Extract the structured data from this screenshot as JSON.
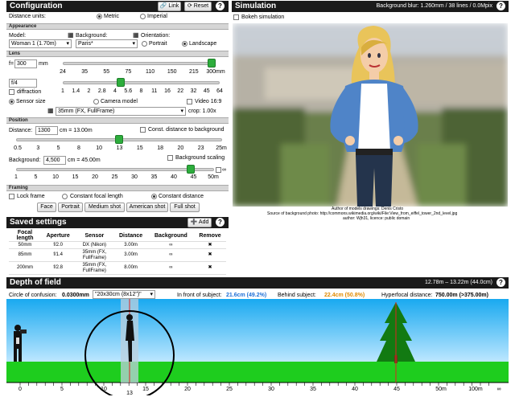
{
  "config": {
    "title": "Configuration",
    "link_label": "Link",
    "reset_label": "Reset",
    "help": "?",
    "distance_units_label": "Distance units:",
    "units": [
      "Metric",
      "Imperial"
    ],
    "appearance_label": "Appearance",
    "model_label": "Model:",
    "model_value": "Woman 1 (1.70m)",
    "background_label": "Background:",
    "background_value": "Paris*",
    "orientation_label": "Orientation:",
    "orientation_options": [
      "Portrait",
      "Landscape"
    ],
    "lens_label": "Lens",
    "focal_prefix": "f=",
    "focal_value": "300",
    "focal_unit": "mm",
    "focal_ticks": [
      "24",
      "35",
      "55",
      "75",
      "110",
      "150",
      "215",
      "300mm"
    ],
    "focal_level": 1.0,
    "aperture_value": "f/4",
    "aperture_ticks": [
      "1",
      "1.4",
      "2",
      "2.8",
      "4",
      "5.6",
      "8",
      "11",
      "16",
      "22",
      "32",
      "45",
      "64"
    ],
    "aperture_level": 0.36,
    "diffraction_label": "diffraction",
    "sensor_size_label": "Sensor size",
    "camera_model_label": "Camera model",
    "video_label": "Video 16:9",
    "sensor_value": "35mm (FX, FullFrame)",
    "crop_label": "crop: 1.00x",
    "position_label": "Position",
    "distance_label": "Distance:",
    "distance_value": "1300",
    "distance_equals": "cm = 13.00m",
    "const_distance_label": "Const. distance to background",
    "distance_ticks": [
      "0.5",
      "3",
      "5",
      "8",
      "10",
      "13",
      "15",
      "18",
      "20",
      "23",
      "25m"
    ],
    "distance_level": 0.5,
    "background_dist_label": "Background:",
    "background_dist_value": "4,500",
    "background_dist_equals": "cm = 45.00m",
    "background_scaling_label": "Background scaling",
    "background_ticks": [
      "1",
      "5",
      "10",
      "15",
      "20",
      "25",
      "30",
      "35",
      "40",
      "45",
      "50m"
    ],
    "background_level": 0.9,
    "infinity": "∞",
    "framing_label": "Framing",
    "lock_frame_label": "Lock frame",
    "constant_focal_label": "Constant focal length",
    "constant_distance_label": "Constant distance",
    "framing_buttons": [
      "Face",
      "Portrait",
      "Medium shot",
      "American shot",
      "Full shot"
    ]
  },
  "saved": {
    "title": "Saved settings",
    "add_label": "Add",
    "columns": [
      "Focal length",
      "Aperture",
      "Sensor",
      "Distance",
      "Background",
      "Remove"
    ],
    "rows": [
      {
        "focal": "50mm",
        "aperture": "f/2.0",
        "sensor": "DX (Nikon)",
        "distance": "3.00m",
        "background": "∞",
        "remove": "✖"
      },
      {
        "focal": "85mm",
        "aperture": "f/1.4",
        "sensor": "35mm (FX, FullFrame)",
        "distance": "3.00m",
        "background": "∞",
        "remove": "✖"
      },
      {
        "focal": "200mm",
        "aperture": "f/2.8",
        "sensor": "35mm (FX, FullFrame)",
        "distance": "8.00m",
        "background": "∞",
        "remove": "✖"
      }
    ]
  },
  "simulation": {
    "title": "Simulation",
    "blur_info": "Background blur: 1.260mm / 38 lines / 0.0Mpix",
    "help": "?",
    "bokeh_label": "Bokeh simulation",
    "credit_1": "Author of models drawings: Denis Cristo",
    "credit_2": "Source of background photo: http://commons.wikimedia.org/wiki/File:View_from_eiffel_tower_2nd_level.jpg",
    "credit_3": "author: Wjh31, licence: public domain"
  },
  "dof": {
    "title": "Depth of field",
    "range": "12.78m – 13.22m (44.0cm)",
    "help": "?",
    "coc_label": "Circle of confusion:",
    "coc_value": "0.0300mm",
    "print_value": "\"20x30cm (8x12\")\"",
    "front_label": "In front of subject:",
    "front_value": "21.6cm (49.2%)",
    "behind_label": "Behind subject:",
    "behind_value": "22.4cm (50.8%)",
    "hyper_label": "Hyperfocal distance:",
    "hyper_value": "750.00m (>375.00m)",
    "scale_ticks": [
      "0",
      "5",
      "10",
      "15",
      "20",
      "25",
      "30",
      "35",
      "40",
      "45",
      "50m",
      "100m",
      "∞"
    ],
    "subject_mark": "13",
    "colors": {
      "front": "#1e6fd6",
      "behind": "#e08a00",
      "thumb": "#2dad3c"
    }
  }
}
